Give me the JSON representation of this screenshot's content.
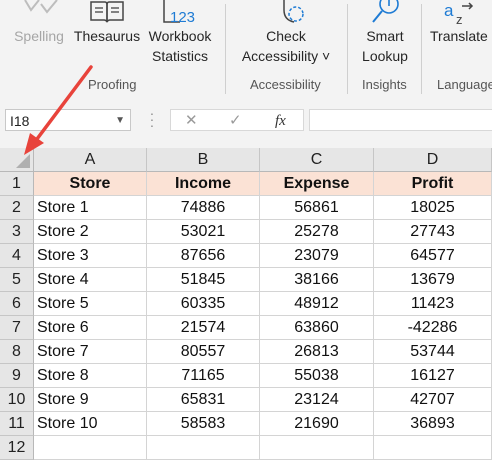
{
  "ribbon": {
    "buttons": {
      "spelling": "Spelling",
      "thesaurus": "Thesaurus",
      "workbook_statistics_line1": "Workbook",
      "workbook_statistics_line2": "Statistics",
      "check_accessibility_line1": "Check",
      "check_accessibility_line2": "Accessibility ˅",
      "smart_lookup_line1": "Smart",
      "smart_lookup_line2": "Lookup",
      "translate": "Translate"
    },
    "groups": {
      "proofing": "Proofing",
      "accessibility": "Accessibility",
      "insights": "Insights",
      "language": "Language"
    },
    "workbook_statistics_icon_text": "123"
  },
  "formula_bar": {
    "name_box": "I18",
    "fx": "fx",
    "cancel": "✕",
    "enter": "✓",
    "formula": ""
  },
  "sheet": {
    "column_headers": [
      "A",
      "B",
      "C",
      "D"
    ],
    "row_headers": [
      "1",
      "2",
      "3",
      "4",
      "5",
      "6",
      "7",
      "8",
      "9",
      "10",
      "11",
      "12"
    ],
    "table_headers": [
      "Store",
      "Income",
      "Expense",
      "Profit"
    ],
    "rows": [
      [
        "Store 1",
        "74886",
        "56861",
        "18025"
      ],
      [
        "Store 2",
        "53021",
        "25278",
        "27743"
      ],
      [
        "Store 3",
        "87656",
        "23079",
        "64577"
      ],
      [
        "Store 4",
        "51845",
        "38166",
        "13679"
      ],
      [
        "Store 5",
        "60335",
        "48912",
        "11423"
      ],
      [
        "Store 6",
        "21574",
        "63860",
        "-42286"
      ],
      [
        "Store 7",
        "80557",
        "26813",
        "53744"
      ],
      [
        "Store 8",
        "71165",
        "55038",
        "16127"
      ],
      [
        "Store 9",
        "65831",
        "23124",
        "42707"
      ],
      [
        "Store 10",
        "58583",
        "21690",
        "36893"
      ]
    ]
  },
  "colors": {
    "header_fill": "#fbe2d5",
    "arrow": "#e8433b",
    "ribbon_bg": "#f3f3f3",
    "icon_blue": "#1e7bd4"
  }
}
